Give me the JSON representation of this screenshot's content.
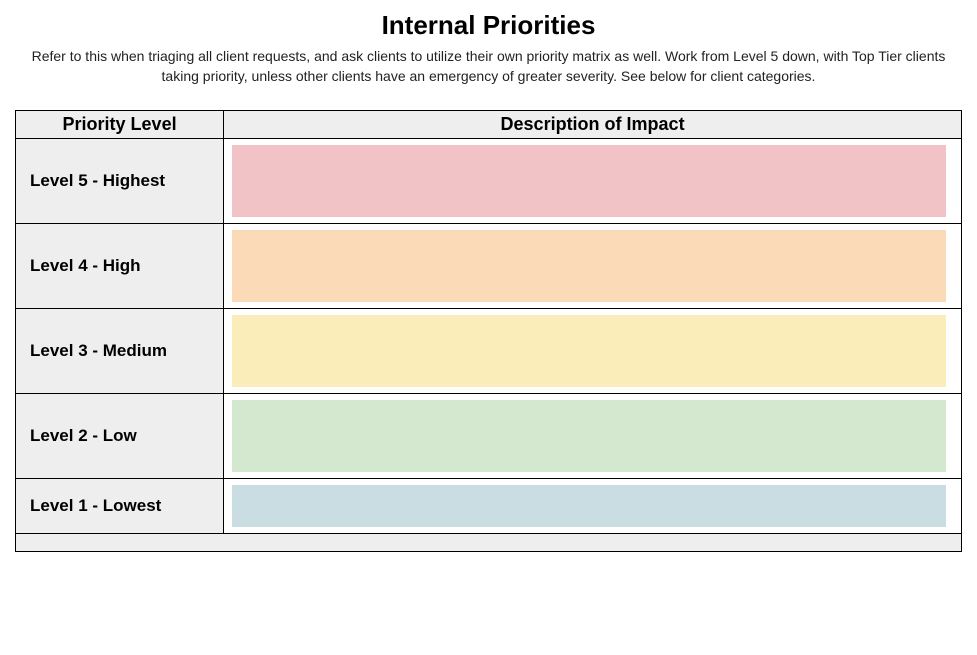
{
  "title": "Internal Priorities",
  "subtitle": "Refer to this when triaging all client requests, and ask clients to utilize their own priority matrix as well. Work from Level 5 down, with Top Tier clients taking priority, unless other clients have an emergency of greater severity. See below for client categories.",
  "headers": {
    "priority": "Priority Level",
    "description": "Description of Impact"
  },
  "rows": [
    {
      "level": "Level 5 - Highest",
      "description": "",
      "color": "#f1c3c7"
    },
    {
      "level": "Level 4 - High",
      "description": "",
      "color": "#fbdbb7"
    },
    {
      "level": "Level 3 - Medium",
      "description": "",
      "color": "#faedb9"
    },
    {
      "level": "Level 2 - Low",
      "description": "",
      "color": "#d4e8cf"
    },
    {
      "level": "Level 1 - Lowest",
      "description": "",
      "color": "#cadde2"
    }
  ]
}
